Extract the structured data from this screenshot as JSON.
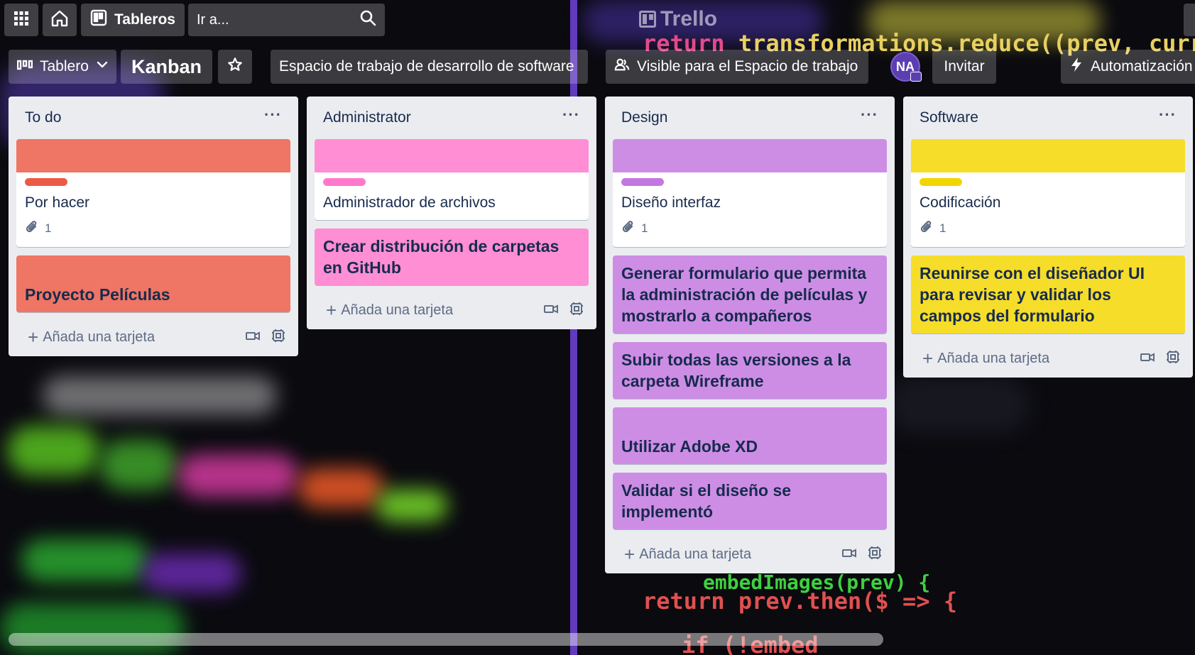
{
  "header": {
    "boards_label": "Tableros",
    "search_placeholder": "Ir a...",
    "logo_text": "Trello"
  },
  "boardbar": {
    "view_label": "Tablero",
    "board_name": "Kanban",
    "workspace_label": "Espacio de trabajo de desarrollo de software",
    "visibility_label": "Visible para el Espacio de trabajo",
    "avatar_initials": "NA",
    "invite_label": "Invitar",
    "automation_label": "Automatización"
  },
  "lists": [
    {
      "title": "To do",
      "menu": "···",
      "add_label": "Añada una tarjeta",
      "labeled_card": {
        "cover_color": "#ef7564",
        "label_color": "#eb5a46",
        "title": "Por hacer",
        "attachments": "1"
      },
      "full_cards": [
        {
          "title": "Proyecto Películas",
          "color": "#ef7564"
        }
      ]
    },
    {
      "title": "Administrator",
      "menu": "···",
      "add_label": "Añada una tarjeta",
      "labeled_card": {
        "cover_color": "#ff8ed4",
        "label_color": "#ff78cb",
        "title": "Administrador de archivos",
        "attachments": ""
      },
      "full_cards": [
        {
          "title": "Crear distribución de carpetas en GitHub",
          "color": "#ff8ed4"
        }
      ]
    },
    {
      "title": "Design",
      "menu": "···",
      "add_label": "Añada una tarjeta",
      "labeled_card": {
        "cover_color": "#cd8de5",
        "label_color": "#c377e0",
        "title": "Diseño interfaz",
        "attachments": "1"
      },
      "full_cards": [
        {
          "title": "Generar formulario que permita la administración de películas y mostrarlo a compañeros",
          "color": "#cd8de5"
        },
        {
          "title": "Subir todas las versiones a la carpeta Wireframe",
          "color": "#cd8de5"
        },
        {
          "title": "Utilizar Adobe XD",
          "color": "#cd8de5"
        },
        {
          "title": "Validar si el diseño se implementó",
          "color": "#cd8de5"
        }
      ]
    },
    {
      "title": "Software",
      "menu": "···",
      "add_label": "Añada una tarjeta",
      "labeled_card": {
        "cover_color": "#f5dd29",
        "label_color": "#f2d600",
        "title": "Codificación",
        "attachments": "1"
      },
      "full_cards": [
        {
          "title": "Reunirse con el diseñador UI para revisar y validar los campos del formulario",
          "color": "#f5dd29"
        }
      ]
    }
  ]
}
